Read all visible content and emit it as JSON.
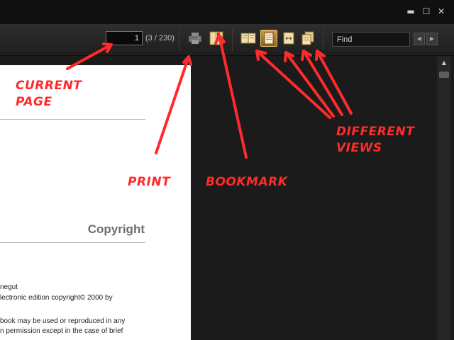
{
  "window": {
    "minimize_glyph": "▬",
    "maximize_glyph": "☐",
    "close_glyph": "✕"
  },
  "toolbar": {
    "page_value": "1",
    "page_count": "(3 / 230)",
    "print_icon": "printer-icon",
    "bookmark_icon": "bookmark-icon",
    "views": [
      {
        "icon": "two-page-view-icon",
        "active": false
      },
      {
        "icon": "single-page-view-icon",
        "active": true
      },
      {
        "icon": "fit-width-view-icon",
        "active": false
      },
      {
        "icon": "continuous-view-icon",
        "active": false
      }
    ],
    "find_value": "Find",
    "prev_glyph": "◀",
    "next_glyph": "▶"
  },
  "document": {
    "heading": "Copyright",
    "lines": [
      "negut",
      "lectronic edition copyright© 2000 by",
      "book may be used or reproduced in any",
      "n permission except in the case of brief"
    ]
  },
  "scrollbar": {
    "up_glyph": "▲"
  },
  "annotations": {
    "current_page_line1": "CURRENT",
    "current_page_line2": "PAGE",
    "print": "PRINT",
    "bookmark": "BOOKMARK",
    "views_line1": "DIFFERENT",
    "views_line2": "VIEWS"
  },
  "colors": {
    "annotation": "#ff2b2b",
    "active_view": "#c99a3c",
    "toolbar_bg": "#2a2a2a"
  }
}
